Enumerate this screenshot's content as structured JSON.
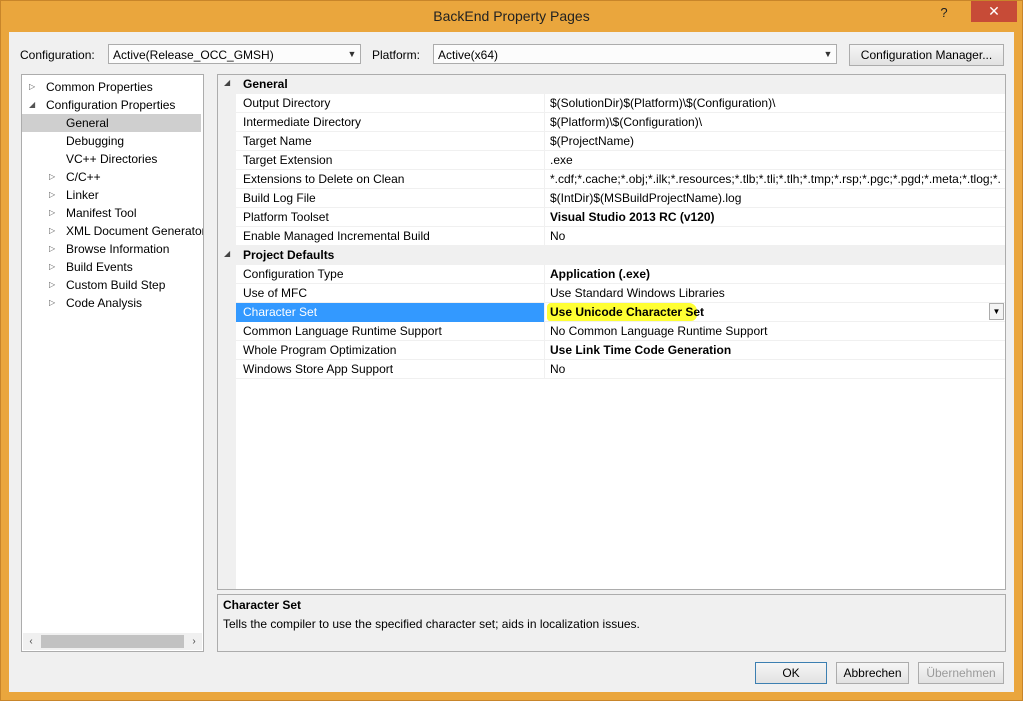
{
  "window": {
    "title": "BackEnd Property Pages",
    "help_label": "?",
    "close_label": "✕"
  },
  "header": {
    "configuration_label": "Configuration:",
    "configuration_value": "Active(Release_OCC_GMSH)",
    "platform_label": "Platform:",
    "platform_value": "Active(x64)",
    "config_manager_label": "Configuration Manager..."
  },
  "tree": {
    "items": [
      {
        "label": "Common Properties",
        "level": 0,
        "toggle": "▷"
      },
      {
        "label": "Configuration Properties",
        "level": 0,
        "toggle": "◢"
      },
      {
        "label": "General",
        "level": 1,
        "toggle": ""
      },
      {
        "label": "Debugging",
        "level": 1,
        "toggle": ""
      },
      {
        "label": "VC++ Directories",
        "level": 1,
        "toggle": ""
      },
      {
        "label": "C/C++",
        "level": 1,
        "toggle": "▷"
      },
      {
        "label": "Linker",
        "level": 1,
        "toggle": "▷"
      },
      {
        "label": "Manifest Tool",
        "level": 1,
        "toggle": "▷"
      },
      {
        "label": "XML Document Generator",
        "level": 1,
        "toggle": "▷"
      },
      {
        "label": "Browse Information",
        "level": 1,
        "toggle": "▷"
      },
      {
        "label": "Build Events",
        "level": 1,
        "toggle": "▷"
      },
      {
        "label": "Custom Build Step",
        "level": 1,
        "toggle": "▷"
      },
      {
        "label": "Code Analysis",
        "level": 1,
        "toggle": "▷"
      }
    ],
    "selected": "General"
  },
  "grid": {
    "general_header": "General",
    "general_rows": [
      {
        "name": "Output Directory",
        "value": "$(SolutionDir)$(Platform)\\$(Configuration)\\",
        "bold": false
      },
      {
        "name": "Intermediate Directory",
        "value": "$(Platform)\\$(Configuration)\\",
        "bold": false
      },
      {
        "name": "Target Name",
        "value": "$(ProjectName)",
        "bold": false
      },
      {
        "name": "Target Extension",
        "value": ".exe",
        "bold": false
      },
      {
        "name": "Extensions to Delete on Clean",
        "value": "*.cdf;*.cache;*.obj;*.ilk;*.resources;*.tlb;*.tli;*.tlh;*.tmp;*.rsp;*.pgc;*.pgd;*.meta;*.tlog;*.",
        "bold": false
      },
      {
        "name": "Build Log File",
        "value": "$(IntDir)$(MSBuildProjectName).log",
        "bold": false
      },
      {
        "name": "Platform Toolset",
        "value": "Visual Studio 2013 RC (v120)",
        "bold": true
      },
      {
        "name": "Enable Managed Incremental Build",
        "value": "No",
        "bold": false
      }
    ],
    "defaults_header": "Project Defaults",
    "defaults_rows": [
      {
        "name": "Configuration Type",
        "value": "Application (.exe)",
        "bold": true
      },
      {
        "name": "Use of MFC",
        "value": "Use Standard Windows Libraries",
        "bold": false
      },
      {
        "name": "Character Set",
        "value": "Use Unicode Character Set",
        "bold": true
      },
      {
        "name": "Common Language Runtime Support",
        "value": "No Common Language Runtime Support",
        "bold": false
      },
      {
        "name": "Whole Program Optimization",
        "value": "Use Link Time Code Generation",
        "bold": true
      },
      {
        "name": "Windows Store App Support",
        "value": "No",
        "bold": false
      }
    ],
    "selected_property": "Character Set",
    "highlight_color": "#ffff33",
    "selection_color": "#3399ff"
  },
  "description": {
    "title": "Character Set",
    "text": "Tells the compiler to use the specified character set; aids in localization issues."
  },
  "footer": {
    "ok_label": "OK",
    "cancel_label": "Abbrechen",
    "apply_label": "Übernehmen"
  }
}
